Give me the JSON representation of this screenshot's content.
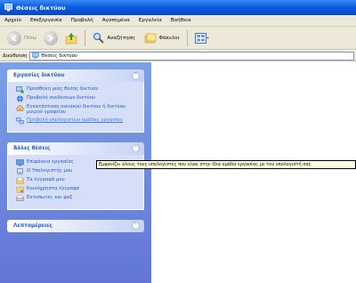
{
  "window": {
    "title": "Θέσεις δικτύου"
  },
  "menu": {
    "items": [
      "Αρχείο",
      "Επεξεργασία",
      "Προβολή",
      "Αγαπημένα",
      "Εργαλεία",
      "Βοήθεια"
    ]
  },
  "toolbar": {
    "back": "Πίσω",
    "search": "Αναζήτηση",
    "folders": "Φάκελοι"
  },
  "address": {
    "label": "Διεύθυνση",
    "value": "Θέσεις δικτύου"
  },
  "network_tasks": {
    "title": "Εργασίες δικτύου",
    "items": [
      {
        "label": "Προσθήκη μιας θέσης δικτύου",
        "icon": "add-place-icon"
      },
      {
        "label": "Προβολή συνδέσεων δικτύου",
        "icon": "network-connections-icon"
      },
      {
        "label": "Εγκατάσταση οικιακού δικτύου ή δικτύου μικρού γραφείου",
        "icon": "setup-network-icon"
      },
      {
        "label": "Προβολή υπολογιστών ομάδας εργασίας",
        "icon": "workgroup-computers-icon"
      }
    ]
  },
  "tooltip": {
    "text": "Εμφανίζει όλους τους υπολογιστές που είναι στην ίδια ομάδα εργασίας με τον υπολογιστή σας"
  },
  "other_places": {
    "title": "Άλλες θέσεις",
    "items": [
      {
        "label": "Επιφάνεια εργασίας",
        "icon": "desktop-icon"
      },
      {
        "label": "Ο Υπολογιστής μου",
        "icon": "my-computer-icon"
      },
      {
        "label": "Τα έγγραφά μου",
        "icon": "my-documents-icon"
      },
      {
        "label": "Κοινόχρηστα έγγραφα",
        "icon": "shared-documents-icon"
      },
      {
        "label": "Εκτυπωτές και φαξ",
        "icon": "printers-icon"
      }
    ]
  },
  "details": {
    "title": "Λεπτομέρειες"
  },
  "colors": {
    "title_bar": "#0a5fe0",
    "task_pane": "#6f8ee0",
    "link": "#215dc6"
  }
}
